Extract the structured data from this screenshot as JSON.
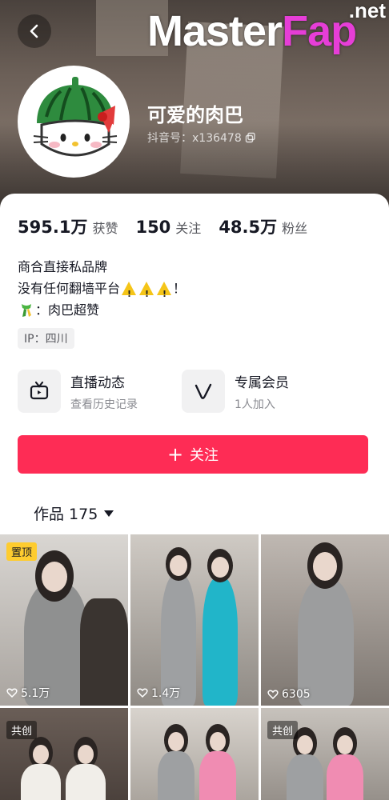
{
  "header": {
    "watermark_main": "Master",
    "watermark_accent": "Fap",
    "watermark_tld": ".net"
  },
  "profile": {
    "nickname": "可爱的肉巴",
    "douyin_id": "抖音号：x136478",
    "avatar_icon": "watermelon-hello-kitty-avatar"
  },
  "stats": [
    {
      "value": "595.1万",
      "label": "获赞"
    },
    {
      "value": "150",
      "label": "关注"
    },
    {
      "value": "48.5万",
      "label": "粉丝"
    }
  ],
  "bio": {
    "line1": "商合直接私品牌",
    "line2_prefix": "没有任何翻墙平台",
    "line2_suffix": "！",
    "line3": "：肉巴超赞"
  },
  "ip_tag": "IP：四川",
  "features": [
    {
      "title": "直播动态",
      "subtitle": "查看历史记录",
      "icon": "tv-icon"
    },
    {
      "title": "专属会员",
      "subtitle": "1人加入",
      "icon": "v-badge-icon"
    }
  ],
  "follow_button": "关注",
  "works_tab": "作品 175",
  "videos": [
    {
      "likes": "5.1万",
      "tag": "置顶"
    },
    {
      "likes": "1.4万",
      "tag": ""
    },
    {
      "likes": "6305",
      "tag": ""
    },
    {
      "likes": "",
      "tag": "共创"
    },
    {
      "likes": "",
      "tag": ""
    },
    {
      "likes": "",
      "tag": "共创"
    }
  ],
  "colors": {
    "accent": "#fe2c55",
    "pinned_tag": "#fecc2f"
  }
}
